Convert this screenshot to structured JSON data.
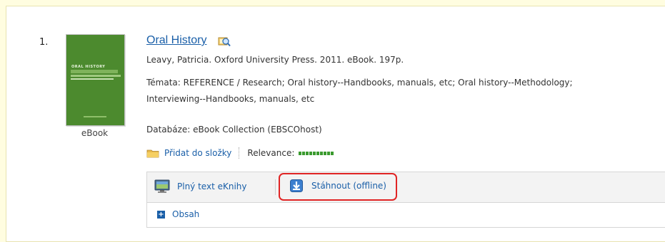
{
  "result": {
    "number": "1.",
    "cover_label": "eBook",
    "cover_text": "ORAL HISTORY",
    "title": "Oral History",
    "author_line": "Leavy, Patricia. Oxford University Press. 2011. eBook. 197p.",
    "subjects_line1": "Témata: REFERENCE / Research; Oral history--Handbooks, manuals, etc; Oral history--Methodology;",
    "subjects_line2": "Interviewing--Handbooks, manuals, etc",
    "database_line": "Databáze: eBook Collection (EBSCOhost)",
    "add_to_folder": "Přidat do složky",
    "relevance_label": "Relevance:",
    "relevance_level": 1.0
  },
  "toolbar": {
    "fulltext_label": "Plný text eKnihy",
    "download_label": "Stáhnout (offline)"
  },
  "contents": {
    "label": "Obsah"
  },
  "colors": {
    "link": "#1a5fa8",
    "cover": "#4c8a2e",
    "highlight": "#e02424",
    "relevance": "#3a9a2e"
  },
  "icons": {
    "title": "preview-magnifier-icon",
    "folder": "folder-icon",
    "fulltext": "monitor-icon",
    "download": "download-icon",
    "contents": "plus-icon"
  }
}
